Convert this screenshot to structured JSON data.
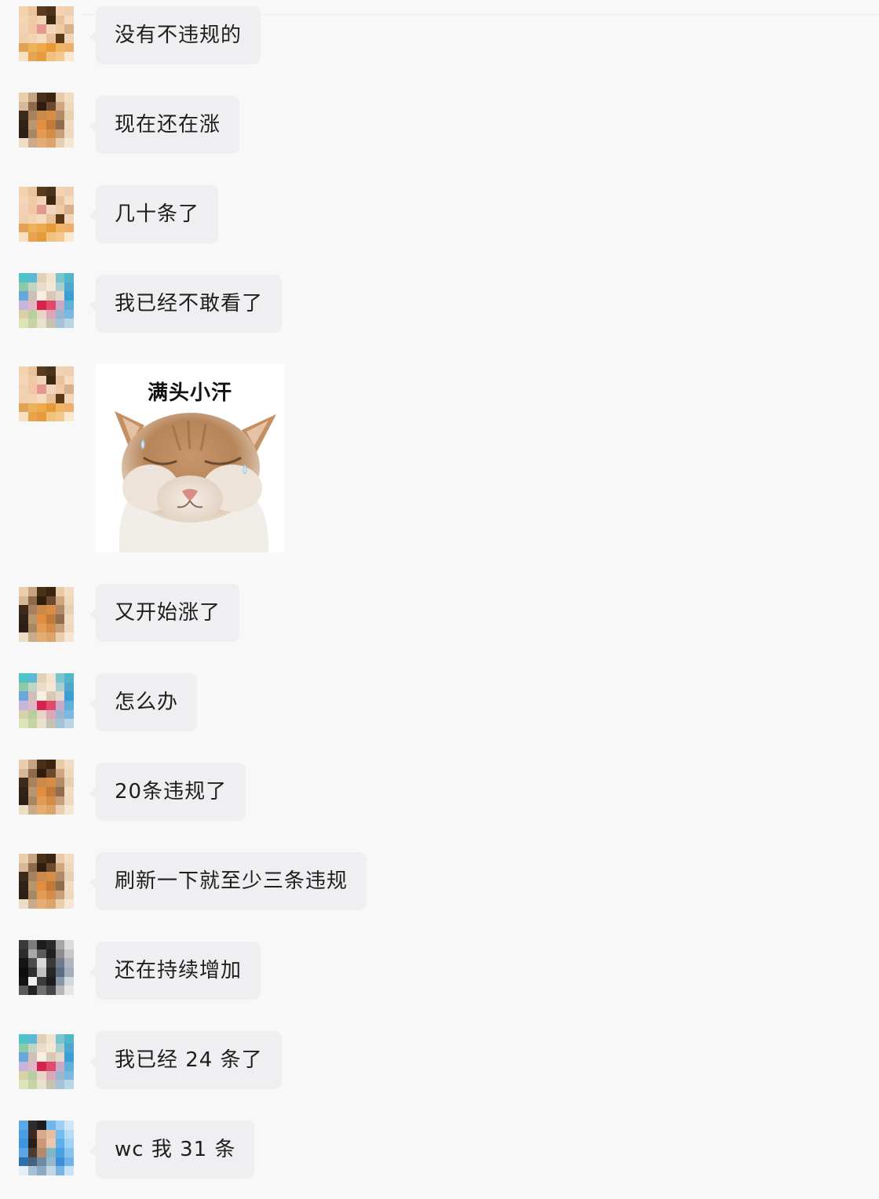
{
  "palette": {
    "background": "#f8f8f9",
    "bubble": "#efeff2",
    "text": "#1e1e1f"
  },
  "messages": [
    {
      "kind": "text",
      "text": "没有不违规的",
      "avatar": "orange-face-avatar"
    },
    {
      "kind": "text",
      "text": "现在还在涨",
      "avatar": "brown-orange-avatar"
    },
    {
      "kind": "text",
      "text": "几十条了",
      "avatar": "orange-face-avatar"
    },
    {
      "kind": "text",
      "text": "我已经不敢看了",
      "avatar": "teal-red-avatar"
    },
    {
      "kind": "sticker",
      "caption": "满头小汗",
      "avatar": "orange-face-avatar",
      "sticker_name": "sweating-cat-sticker"
    },
    {
      "kind": "text",
      "text": "又开始涨了",
      "avatar": "brown-orange-avatar"
    },
    {
      "kind": "text",
      "text": "怎么办",
      "avatar": "teal-red-avatar"
    },
    {
      "kind": "text",
      "text": "20条违规了",
      "avatar": "brown-orange-avatar"
    },
    {
      "kind": "text",
      "text": "刷新一下就至少三条违规",
      "avatar": "brown-orange-avatar"
    },
    {
      "kind": "text",
      "text": "还在持续增加",
      "avatar": "dark-grey-avatar"
    },
    {
      "kind": "text",
      "text": "我已经 24 条了",
      "avatar": "teal-red-avatar"
    },
    {
      "kind": "text",
      "text": "wc 我 31 条",
      "avatar": "blue-person-avatar"
    }
  ]
}
